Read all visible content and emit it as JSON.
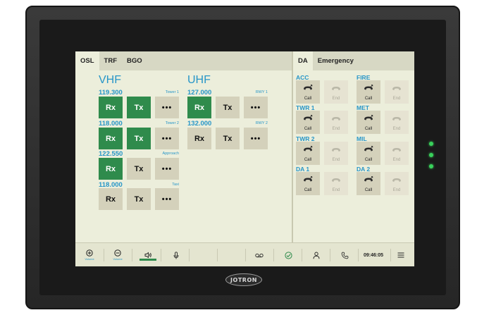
{
  "tabs_left": [
    "OSL",
    "TRF",
    "BGO"
  ],
  "tabs_right": [
    "DA",
    "Emergency"
  ],
  "vhf": {
    "title": "VHF",
    "channels": [
      {
        "freq": "119.300",
        "label": "Tower 1",
        "rx": "Rx",
        "tx": "Tx",
        "more": "•••"
      },
      {
        "freq": "118.000",
        "label": "Tower 2",
        "rx": "Rx",
        "tx": "Tx",
        "more": "•••"
      },
      {
        "freq": "122.550",
        "label": "Approach",
        "rx": "Rx",
        "tx": "Tx",
        "more": "•••"
      },
      {
        "freq": "118.000",
        "label": "Taxi",
        "rx": "Rx",
        "tx": "Tx",
        "more": "•••"
      }
    ]
  },
  "uhf": {
    "title": "UHF",
    "channels": [
      {
        "freq": "127.000",
        "label": "RWY 1",
        "rx": "Rx",
        "tx": "Tx",
        "more": "•••"
      },
      {
        "freq": "132.000",
        "label": "RWY 2",
        "rx": "Rx",
        "tx": "Tx",
        "more": "•••"
      }
    ]
  },
  "da": {
    "call_label": "Call",
    "end_label": "End",
    "lines": [
      "ACC",
      "FIRE",
      "TWR 1",
      "MET",
      "TWR 2",
      "MIL",
      "DA 1",
      "DA 2"
    ]
  },
  "bottom": {
    "volume_up_caption": "Volume",
    "volume_down_caption": "Volume",
    "clock": "09:46:05"
  },
  "brand": "JOTRON",
  "colors": {
    "accent": "#2796c8",
    "active_green": "#2f8b4c",
    "screen_bg": "#eceedb",
    "button_bg": "#d4d1bb",
    "led_green": "#39d15b"
  }
}
